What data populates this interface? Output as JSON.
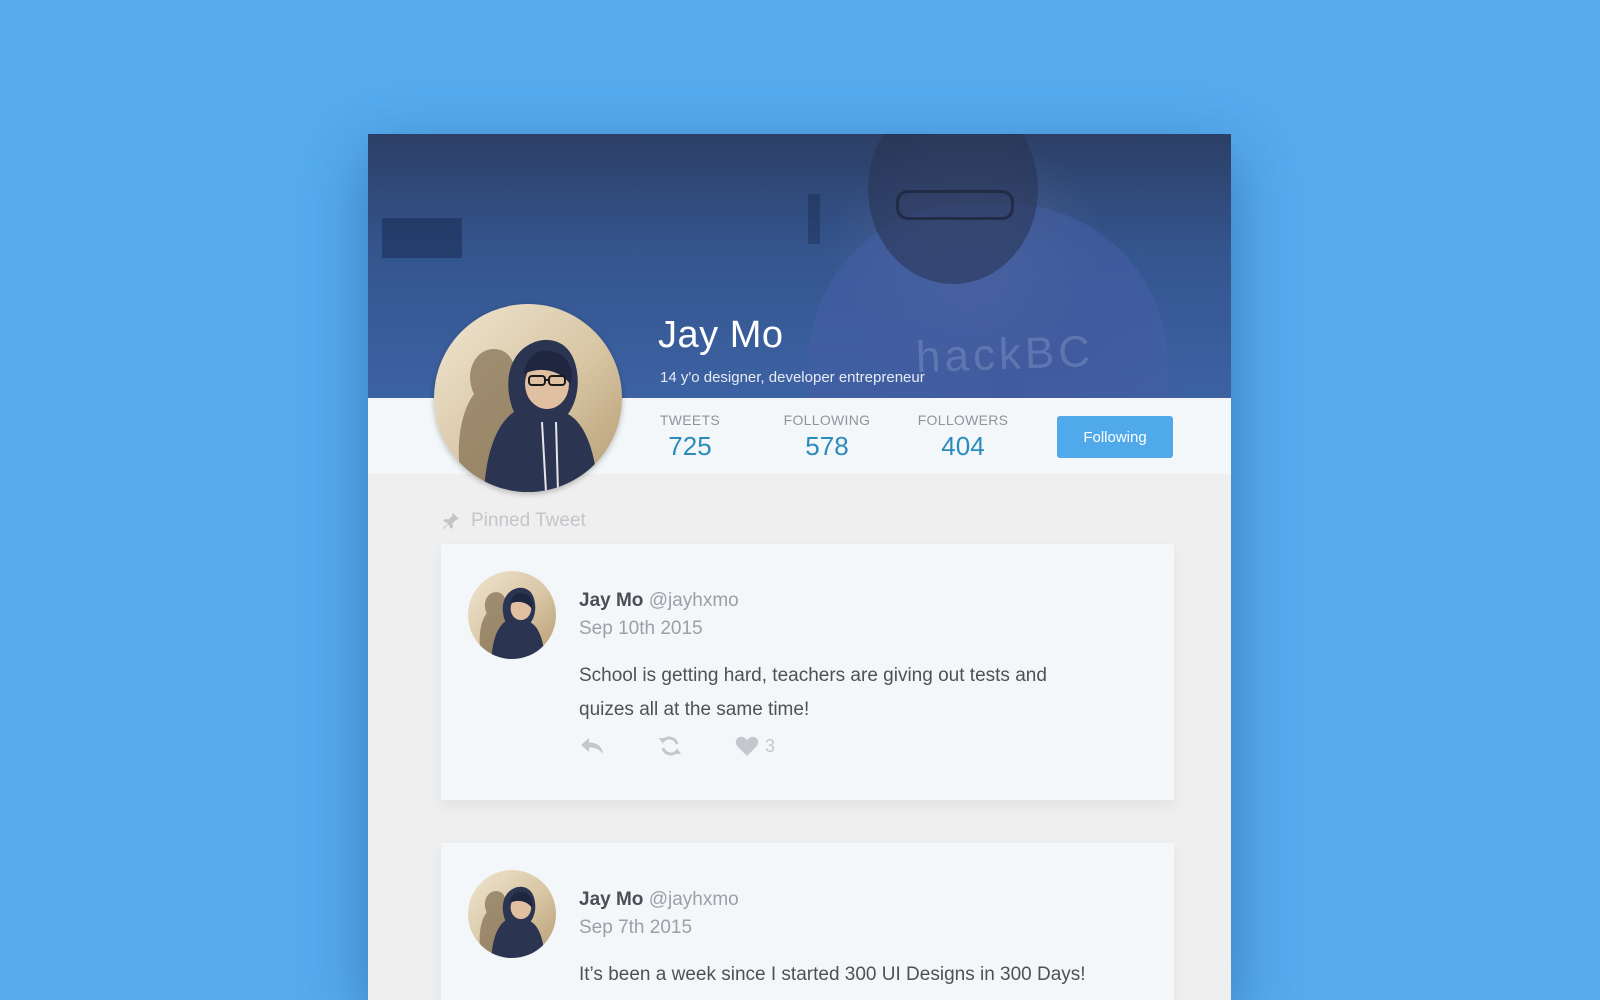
{
  "profile": {
    "name": "Jay Mo",
    "bio": "14 y'o designer, developer entrepreneur",
    "cover_text": "hackBC"
  },
  "stats": [
    {
      "label": "TWEETS",
      "value": "725"
    },
    {
      "label": "FOLLOWING",
      "value": "578"
    },
    {
      "label": "FOLLOWERS",
      "value": "404"
    }
  ],
  "follow_button": {
    "label": "Following"
  },
  "pinned": {
    "label": "Pinned Tweet"
  },
  "tweets": [
    {
      "name": "Jay Mo",
      "handle": "@jayhxmo",
      "date": "Sep 10th 2015",
      "text": "School is getting hard, teachers are giving out tests and quizes all at the same time!",
      "likes": "3"
    },
    {
      "name": "Jay Mo",
      "handle": "@jayhxmo",
      "date": "Sep 7th 2015",
      "text": "It’s been a week since I started 300 UI Designs in 300 Days!"
    }
  ],
  "icons": {
    "pin": "pin-icon",
    "reply": "reply-icon",
    "retweet": "retweet-icon",
    "like": "heart-icon"
  },
  "colors": {
    "background": "#56acef",
    "accent": "#4fa9ea",
    "stat_value": "#2a8cbd"
  }
}
